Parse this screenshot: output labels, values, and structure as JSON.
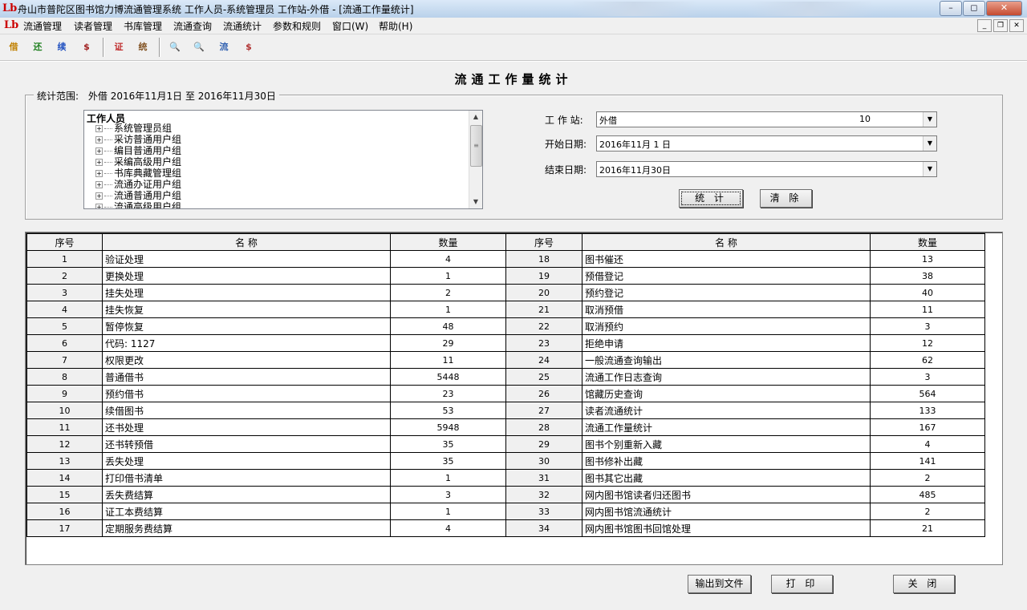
{
  "window": {
    "title": "舟山市普陀区图书馆力博流通管理系统 工作人员-系统管理员 工作站-外借 - [流通工作量统计]",
    "app_icon": "Lb",
    "buttons": {
      "minimize": "–",
      "restore": "◻",
      "close": "✕"
    }
  },
  "menu": {
    "icon": "Lb",
    "items": [
      "流通管理",
      "读者管理",
      "书库管理",
      "流通查询",
      "流通统计",
      "参数和规则",
      "窗口(W)",
      "帮助(H)"
    ],
    "mdi_buttons": {
      "minimize": "_",
      "restore": "❐",
      "close": "✕"
    }
  },
  "toolbar": {
    "buttons": [
      {
        "icon": "borrow-icon",
        "glyph": "借",
        "color": "#c08000"
      },
      {
        "icon": "return-icon",
        "glyph": "还",
        "color": "#208020"
      },
      {
        "icon": "renew-icon",
        "glyph": "续",
        "color": "#2050c0"
      },
      {
        "icon": "fine-icon",
        "glyph": "$",
        "color": "#a02020"
      },
      {
        "icon": "reader-icon",
        "glyph": "证",
        "color": "#c03030"
      },
      {
        "icon": "stats-icon",
        "glyph": "统",
        "color": "#805020"
      },
      {
        "icon": "search-book-icon",
        "glyph": "🔍",
        "color": "#2060a0"
      },
      {
        "icon": "search-reader-icon",
        "glyph": "🔍",
        "color": "#6060a0"
      },
      {
        "icon": "circulation-chart-icon",
        "glyph": "流",
        "color": "#3060b0"
      },
      {
        "icon": "fee-chart-icon",
        "glyph": "$",
        "color": "#b03030"
      }
    ]
  },
  "form": {
    "heading": "流通工作量统计",
    "scope_label": "统计范围:",
    "scope_value": "外借  2016年11月1日  至  2016年11月30日",
    "tree_root": "工作人员",
    "tree_nodes": [
      "系统管理员组",
      "采访普通用户组",
      "编目普通用户组",
      "采编高级用户组",
      "书库典藏管理组",
      "流通办证用户组",
      "流通普通用户组",
      "流通高级用户组"
    ],
    "workstation_label": "工 作 站:",
    "workstation_value": "外借",
    "workstation_code": "10",
    "start_label": "开始日期:",
    "start_value": "2016年11月 1 日",
    "end_label": "结束日期:",
    "end_value": "2016年11月30日",
    "stat_button": "统 计",
    "clear_button": "清 除"
  },
  "table": {
    "headers": [
      "序号",
      "名    称",
      "数量",
      "序号",
      "名    称",
      "数量"
    ],
    "rows": [
      [
        1,
        "验证处理",
        4,
        18,
        "图书催还",
        13
      ],
      [
        2,
        "更换处理",
        1,
        19,
        "预借登记",
        38
      ],
      [
        3,
        "挂失处理",
        2,
        20,
        "预约登记",
        40
      ],
      [
        4,
        "挂失恢复",
        1,
        21,
        "取消预借",
        11
      ],
      [
        5,
        "暂停恢复",
        48,
        22,
        "取消预约",
        3
      ],
      [
        6,
        "代码: 1127",
        29,
        23,
        "拒绝申请",
        12
      ],
      [
        7,
        "权限更改",
        11,
        24,
        "一般流通查询输出",
        62
      ],
      [
        8,
        "普通借书",
        5448,
        25,
        "流通工作日志查询",
        3
      ],
      [
        9,
        "预约借书",
        23,
        26,
        "馆藏历史查询",
        564
      ],
      [
        10,
        "续借图书",
        53,
        27,
        "读者流通统计",
        133
      ],
      [
        11,
        "还书处理",
        5948,
        28,
        "流通工作量统计",
        167
      ],
      [
        12,
        "还书转预借",
        35,
        29,
        "图书个别重新入藏",
        4
      ],
      [
        13,
        "丢失处理",
        35,
        30,
        "图书修补出藏",
        141
      ],
      [
        14,
        "打印借书清单",
        1,
        31,
        "图书其它出藏",
        2
      ],
      [
        15,
        "丢失费结算",
        3,
        32,
        "网内图书馆读者归还图书",
        485
      ],
      [
        16,
        "证工本费结算",
        1,
        33,
        "网内图书馆流通统计",
        2
      ],
      [
        17,
        "定期服务费结算",
        4,
        34,
        "网内图书馆图书回馆处理",
        21
      ]
    ]
  },
  "footer": {
    "export_button": "输出到文件",
    "print_button": "打 印",
    "close_button": "关 闭"
  }
}
